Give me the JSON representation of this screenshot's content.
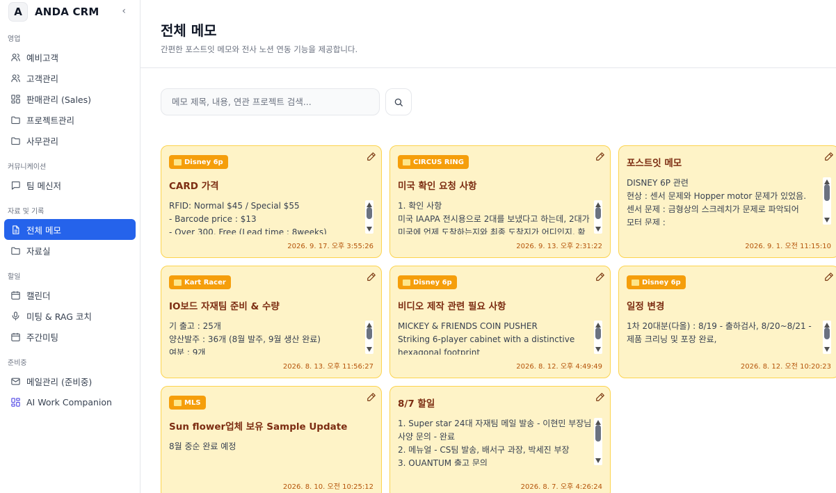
{
  "brand": {
    "logo": "A",
    "name": "ANDA CRM",
    "collapse": "‹"
  },
  "sidebar": {
    "sections": [
      {
        "label": "영업",
        "items": [
          {
            "label": "예비고객",
            "icon": "users-icon"
          },
          {
            "label": "고객관리",
            "icon": "users-icon"
          },
          {
            "label": "판매관리 (Sales)",
            "icon": "grid-icon"
          },
          {
            "label": "프로젝트관리",
            "icon": "folder-icon"
          },
          {
            "label": "사무관리",
            "icon": "folder-icon"
          }
        ]
      },
      {
        "label": "커뮤니케이션",
        "items": [
          {
            "label": "팀 메신저",
            "icon": "message-icon"
          }
        ]
      },
      {
        "label": "자료 및 기록",
        "items": [
          {
            "label": "전체 메모",
            "icon": "document-icon",
            "active": true
          },
          {
            "label": "자료실",
            "icon": "folder-icon"
          }
        ]
      },
      {
        "label": "할일",
        "items": [
          {
            "label": "캘린더",
            "icon": "calendar-icon"
          },
          {
            "label": "미팅 & RAG 코치",
            "icon": "mic-icon"
          },
          {
            "label": "주간미팅",
            "icon": "calendar-icon"
          }
        ]
      },
      {
        "label": "준비중",
        "items": [
          {
            "label": "메일관리 (준비중)",
            "icon": "mail-icon"
          },
          {
            "label": "AI Work Companion",
            "icon": "grid-icon"
          }
        ]
      }
    ]
  },
  "header": {
    "title": "전체 메모",
    "subtitle": "간편한 포스트잇 메모와 전사 노션 연동 기능을 제공합니다."
  },
  "search": {
    "placeholder": "메모 제목, 내용, 연관 프로젝트 검색..."
  },
  "memos": [
    {
      "tag": "Disney 6p",
      "title": "CARD 가격",
      "lines": [
        "RFID: Normal $45 / Special $55",
        " - Barcode price : $13",
        " - Over 300, Free (Lead time : 8weeks)"
      ],
      "date": "2026. 9. 17. 오후 3:55:26",
      "scroll": 0.0
    },
    {
      "tag": "CIRCUS RING",
      "title": "미국 확인 요청 사항",
      "lines": [
        "1. 확인 사항",
        "미국 IAAPA 전시용으로 2대를 보냈다고 하는데, 2대가",
        "미국에 언제 도착하는지와 최종 도착지가 어디인지, 확"
      ],
      "date": "2026. 9. 13. 오후 2:31:22",
      "scroll": 0.0
    },
    {
      "tag": "",
      "title": "포스트잇 메모",
      "lines": [
        "DISNEY 6P 관련",
        "현상 : 센서 문제와 Hopper motor 문제가 있었음.",
        "센서 문제 : 금형상의 스크레치가 문제로 파악되어",
        "모터 문제 :"
      ],
      "date": "2026. 9. 1. 오전 11:15:10",
      "scroll": 0.0
    },
    {
      "tag": "Kart Racer",
      "title": "IO보드 자재팀 준비 & 수량",
      "lines": [
        "기 출고 : 25개",
        "양산발주 : 36개 (8월 발주, 9월 생산 완료)",
        "여분 : 9개"
      ],
      "date": "2026. 8. 13. 오후 11:56:27",
      "scroll": 0.0
    },
    {
      "tag": "Disney 6p",
      "title": "비디오 제작 관련 필요 사항",
      "lines": [
        "MICKEY & FRIENDS COIN PUSHER",
        "Striking 6-player cabinet with a distinctive",
        "hexagonal footprint"
      ],
      "date": "2026. 8. 12. 오후 4:49:49",
      "scroll": 0.0
    },
    {
      "tag": "Disney 6p",
      "title": "일정 변경",
      "lines": [
        "1차 20대분(다올) :  8/19 - 출하검사,   8/20~8/21 -",
        "제품 크리닝 및 포장 완료,"
      ],
      "date": "2026. 8. 12. 오전 10:20:23",
      "scroll": 0.0
    },
    {
      "tag": "MLS",
      "title": "Sun flower업체 보유 Sample Update",
      "lines": [
        "8월 중순 완료 예정"
      ],
      "date": "2026. 8. 10. 오전 10:25:12",
      "scroll": null
    },
    {
      "tag": "",
      "title": "8/7 할일",
      "lines": [
        "1. Super star 24대 자재팀 메일 발송 - 이현민 부장님",
        "사양 문의 - 완료",
        "2. 메뉴얼 - CS팀 발송, 배서구 과장, 박세진 부장",
        "3. QUANTUM 출고 문의"
      ],
      "date": "2026. 8. 7. 오후 4:26:24",
      "scroll": 0.0
    }
  ]
}
